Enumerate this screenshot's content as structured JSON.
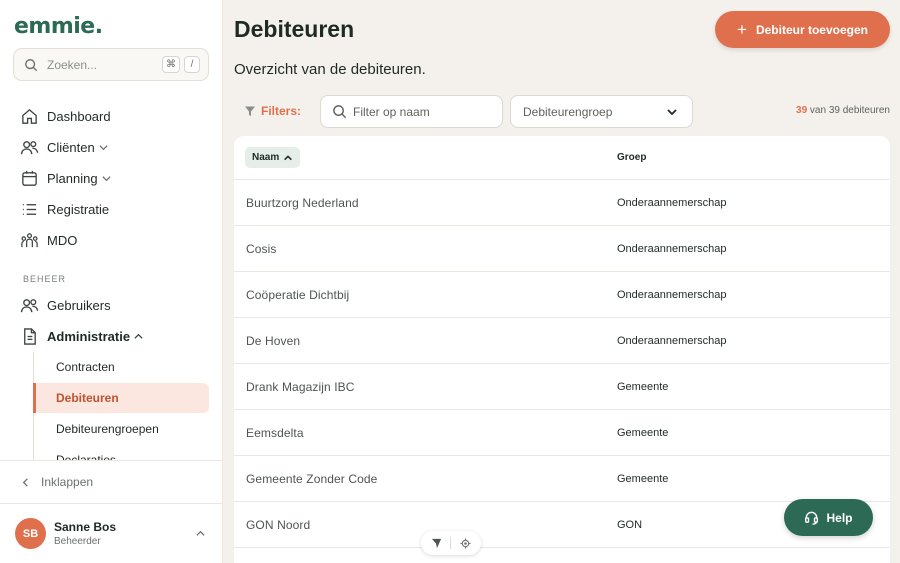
{
  "brand": {
    "logo_text": "emmie.",
    "accent": "#e0704d",
    "primary": "#2d6a55"
  },
  "sidebar": {
    "search": {
      "placeholder": "Zoeken...",
      "kbd1": "⌘",
      "kbd2": "/"
    },
    "items": [
      {
        "label": "Dashboard",
        "icon": "home-icon"
      },
      {
        "label": "Cliënten",
        "icon": "users-icon"
      },
      {
        "label": "Planning",
        "icon": "calendar-icon"
      },
      {
        "label": "Registratie",
        "icon": "list-icon"
      },
      {
        "label": "MDO",
        "icon": "team-icon"
      }
    ],
    "section_label": "BEHEER",
    "beheer_items": [
      {
        "label": "Gebruikers",
        "icon": "users-icon"
      },
      {
        "label": "Administratie",
        "icon": "document-icon"
      }
    ],
    "sub_items": [
      {
        "label": "Contracten"
      },
      {
        "label": "Debiteuren",
        "active": true
      },
      {
        "label": "Debiteurengroepen"
      },
      {
        "label": "Declaraties"
      }
    ],
    "collapse_label": "Inklappen",
    "user": {
      "initials": "SB",
      "name": "Sanne Bos",
      "role": "Beheerder"
    }
  },
  "main": {
    "title": "Debiteuren",
    "subtitle": "Overzicht van de debiteuren.",
    "add_button": "Debiteur toevoegen",
    "filters_label": "Filters:",
    "name_filter_placeholder": "Filter op naam",
    "group_filter_value": "Debiteurengroep",
    "count_shown": "39",
    "count_rest": "van 39 debiteuren",
    "table": {
      "columns": [
        "Naam",
        "Groep"
      ],
      "rows": [
        {
          "name": "Buurtzorg Nederland",
          "group": "Onderaannemerschap"
        },
        {
          "name": "Cosis",
          "group": "Onderaannemerschap"
        },
        {
          "name": "Coöperatie Dichtbij",
          "group": "Onderaannemerschap"
        },
        {
          "name": "De Hoven",
          "group": "Onderaannemerschap"
        },
        {
          "name": "Drank Magazijn IBC",
          "group": "Gemeente"
        },
        {
          "name": "Eemsdelta",
          "group": "Gemeente"
        },
        {
          "name": "Gemeente Zonder Code",
          "group": "Gemeente"
        },
        {
          "name": "GON Noord",
          "group": "GON"
        }
      ]
    },
    "help_button": "Help"
  }
}
